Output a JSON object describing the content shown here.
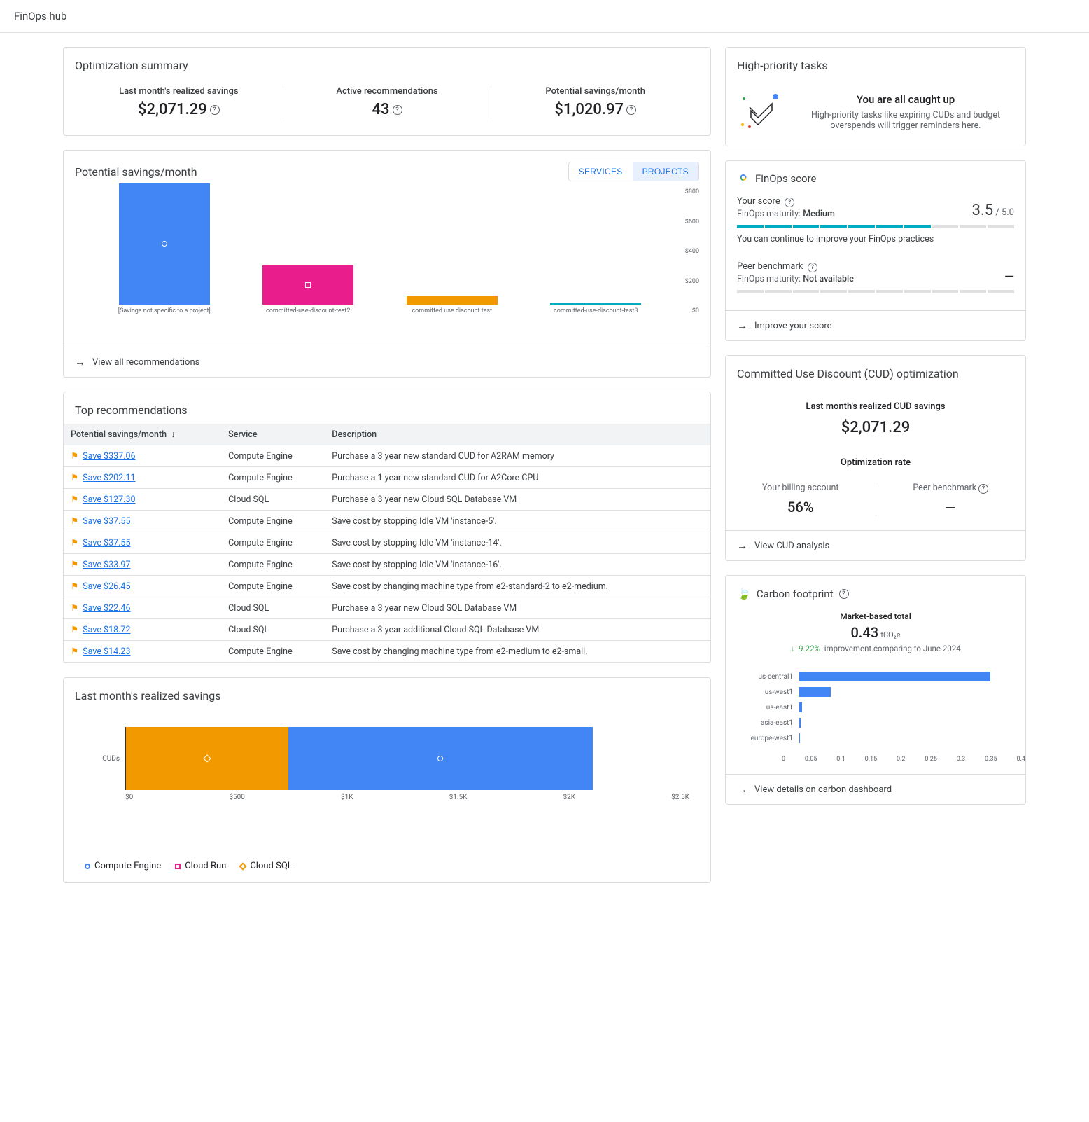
{
  "pageTitle": "FinOps hub",
  "optSummary": {
    "title": "Optimization summary",
    "items": [
      {
        "label": "Last month's realized savings",
        "value": "$2,071.29"
      },
      {
        "label": "Active recommendations",
        "value": "43"
      },
      {
        "label": "Potential savings/month",
        "value": "$1,020.97"
      }
    ]
  },
  "highPriority": {
    "title": "High-priority tasks",
    "headline": "You are all caught up",
    "subtext": "High-priority tasks like expiring CUDs and budget overspends will trigger reminders here."
  },
  "potentialSavings": {
    "title": "Potential savings/month",
    "toggles": {
      "services": "SERVICES",
      "projects": "PROJECTS"
    },
    "footer": "View all recommendations"
  },
  "chart_data": [
    {
      "type": "bar",
      "id": "potential_savings_by_project",
      "ylabel": "$",
      "ylim": [
        0,
        800
      ],
      "yticks": [
        "$0",
        "$200",
        "$400",
        "$600",
        "$800"
      ],
      "categories": [
        "[Savings not specific to a project]",
        "committed-use-discount-test2",
        "committed use discount test",
        "committed-use-discount-test3"
      ],
      "values": [
        770,
        250,
        60,
        10
      ],
      "colors": [
        "#4285f4",
        "#e91e8c",
        "#f29900",
        "#00acc1"
      ]
    },
    {
      "type": "bar",
      "id": "realized_savings_last_month",
      "orientation": "horizontal-stacked",
      "category": "CUDs",
      "xlabel": "$",
      "xlim": [
        0,
        2500
      ],
      "xticks": [
        "$0",
        "$500",
        "$1K",
        "$1.5K",
        "$2K",
        "$2.5K"
      ],
      "series": [
        {
          "name": "Compute Engine",
          "value": 1350,
          "color": "#4285f4"
        },
        {
          "name": "Cloud Run",
          "value": 0,
          "color": "#e91e8c"
        },
        {
          "name": "Cloud SQL",
          "value": 720,
          "color": "#f29900"
        }
      ],
      "total": 2070
    },
    {
      "type": "bar",
      "id": "carbon_by_region",
      "orientation": "horizontal",
      "xlim": [
        0,
        0.4
      ],
      "xticks": [
        "0",
        "0.05",
        "0.1",
        "0.15",
        "0.2",
        "0.25",
        "0.3",
        "0.35",
        "0.4"
      ],
      "categories": [
        "us-central1",
        "us-west1",
        "us-east1",
        "asia-east1",
        "europe-west1"
      ],
      "values": [
        0.365,
        0.06,
        0.005,
        0.003,
        0.001
      ],
      "color": "#4285f4"
    }
  ],
  "finopsScore": {
    "title": "FinOps score",
    "yourScoreLabel": "Your score",
    "maturityLabel": "FinOps maturity:",
    "maturityValue": "Medium",
    "score": "3.5",
    "scoreMax": "/ 5.0",
    "note": "You can continue to improve your FinOps practices",
    "peerLabel": "Peer benchmark",
    "peerMaturity": "Not available",
    "peerValue": "—",
    "footer": "Improve your score"
  },
  "topRecs": {
    "title": "Top recommendations",
    "columns": {
      "savings": "Potential savings/month",
      "service": "Service",
      "description": "Description"
    },
    "rows": [
      {
        "savings": "Save $337.06",
        "service": "Compute Engine",
        "desc": "Purchase a 3 year new standard CUD for A2RAM memory"
      },
      {
        "savings": "Save $202.11",
        "service": "Compute Engine",
        "desc": "Purchase a 1 year new standard CUD for A2Core CPU"
      },
      {
        "savings": "Save $127.30",
        "service": "Cloud SQL",
        "desc": "Purchase a 3 year new Cloud SQL Database VM"
      },
      {
        "savings": "Save $37.55",
        "service": "Compute Engine",
        "desc": "Save cost by stopping Idle VM 'instance-5'."
      },
      {
        "savings": "Save $37.55",
        "service": "Compute Engine",
        "desc": "Save cost by stopping Idle VM 'instance-14'."
      },
      {
        "savings": "Save $33.97",
        "service": "Compute Engine",
        "desc": "Save cost by stopping Idle VM 'instance-16'."
      },
      {
        "savings": "Save $26.45",
        "service": "Compute Engine",
        "desc": "Save cost by changing machine type from e2-standard-2 to e2-medium."
      },
      {
        "savings": "Save $22.46",
        "service": "Cloud SQL",
        "desc": "Purchase a 3 year new Cloud SQL Database VM"
      },
      {
        "savings": "Save $18.72",
        "service": "Cloud SQL",
        "desc": "Purchase a 3 year additional Cloud SQL Database VM"
      },
      {
        "savings": "Save $14.23",
        "service": "Compute Engine",
        "desc": "Save cost by changing machine type from e2-medium to e2-small."
      }
    ]
  },
  "cud": {
    "title": "Committed Use Discount (CUD) optimization",
    "realizedLabel": "Last month's realized CUD savings",
    "realizedValue": "$2,071.29",
    "rateLabel": "Optimization rate",
    "yourAccountLabel": "Your billing account",
    "yourAccountValue": "56%",
    "peerLabel": "Peer benchmark",
    "peerValue": "—",
    "footer": "View CUD analysis"
  },
  "realizedSavings": {
    "title": "Last month's realized savings",
    "legend": {
      "ce": "Compute Engine",
      "cr": "Cloud Run",
      "cs": "Cloud SQL"
    }
  },
  "carbon": {
    "title": "Carbon footprint",
    "totalLabel": "Market-based total",
    "totalValue": "0.43",
    "totalUnit": "tCO₂e",
    "improvement": "-9.22%",
    "improvementText": "improvement comparing to June 2024",
    "footer": "View details on carbon dashboard"
  }
}
